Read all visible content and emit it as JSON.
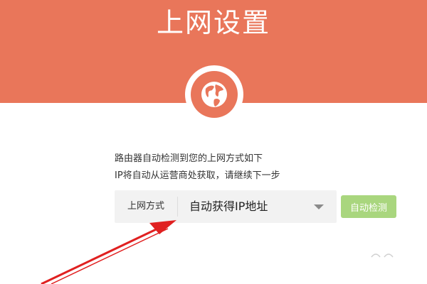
{
  "header": {
    "title": "上网设置",
    "background_color": "#e9765a",
    "icon": "globe-icon"
  },
  "info": {
    "line1": "路由器自动检测到您的上网方式如下",
    "line2": "IP将自动从运营商处获取，请继续下一步"
  },
  "connection": {
    "label": "上网方式",
    "selected_value": "自动获得IP地址",
    "dropdown_icon": "chevron-down-icon"
  },
  "detect_button": {
    "label": "自动检测",
    "color": "#a9d67e"
  },
  "annotation": {
    "arrow_color": "#e02020",
    "icon": "red-arrow-annotation"
  }
}
